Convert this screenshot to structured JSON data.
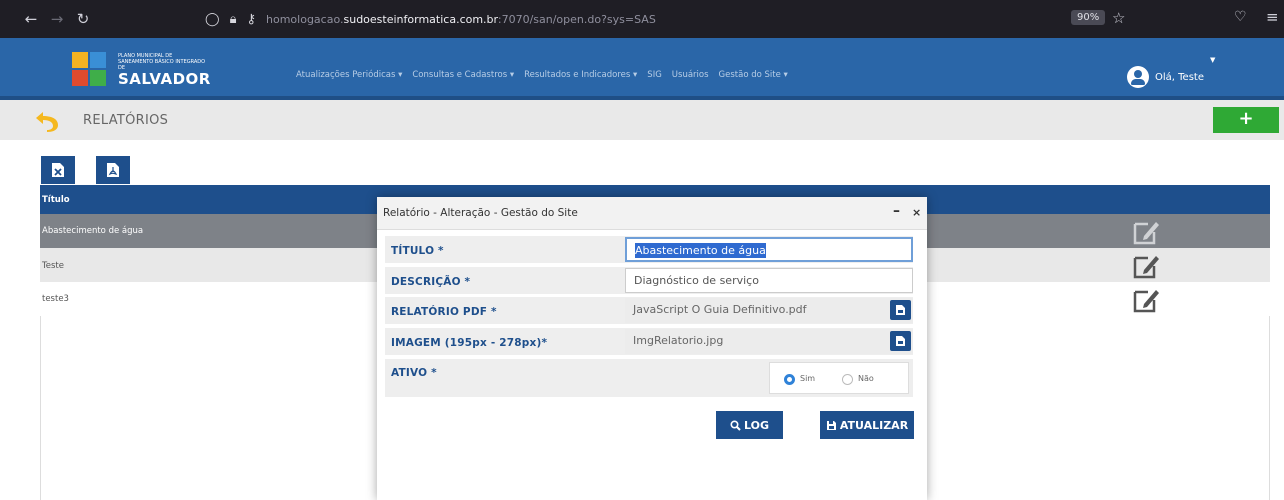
{
  "browser": {
    "url_prefix": "homologacao.",
    "url_domain": "sudoesteinformatica.com.br",
    "url_rest": ":7070/san/open.do?sys=SAS",
    "zoom": "90%"
  },
  "header": {
    "logo_small_text": "PLANO MUNICIPAL DE SANEAMENTO BÁSICO INTEGRADO DE",
    "logo_main_text": "SALVADOR",
    "nav": [
      {
        "label": "Atualizações Periódicas ▾"
      },
      {
        "label": "Consultas e Cadastros ▾"
      },
      {
        "label": "Resultados e Indicadores ▾"
      },
      {
        "label": "SIG"
      },
      {
        "label": "Usuários"
      },
      {
        "label": "Gestão do Site ▾"
      }
    ],
    "user_greeting": "Olá, Teste"
  },
  "subheader": {
    "title": "RELATÓRIOS",
    "add_label": "+"
  },
  "table": {
    "column_title": "Título",
    "rows": [
      {
        "title": "Abastecimento de água"
      },
      {
        "title": "Teste"
      },
      {
        "title": "teste3"
      }
    ]
  },
  "modal": {
    "title": "Relatório - Alteração - Gestão do Site",
    "minimize": "–",
    "close": "×",
    "fields": {
      "titulo_label": "TÍTULO *",
      "titulo_value": "Abastecimento de água",
      "descricao_label": "DESCRIÇÃO *",
      "descricao_value": "Diagnóstico de serviço",
      "pdf_label": "RELATÓRIO PDF *",
      "pdf_value": "JavaScript O Guia Definitivo.pdf",
      "imagem_label": "IMAGEM (195px - 278px)*",
      "imagem_value": "ImgRelatorio.jpg",
      "ativo_label": "ATIVO *",
      "ativo_sim": "Sim",
      "ativo_nao": "Não"
    },
    "log_label": "LOG",
    "update_label": "ATUALIZAR"
  },
  "colors": {
    "header_blue": "#2a66a8",
    "dark_blue": "#1e4f8c",
    "add_green": "#2fa935",
    "selected_row": "#7e8288"
  }
}
